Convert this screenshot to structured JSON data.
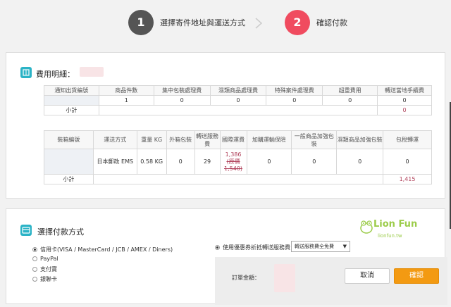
{
  "steps": {
    "step1": {
      "number": "1",
      "label": "選擇寄件地址與運送方式"
    },
    "step2": {
      "number": "2",
      "label": "確認付款"
    }
  },
  "fee": {
    "title": "費用明細：",
    "table1": {
      "headers": [
        "通知出貨編號",
        "商品件數",
        "集中包裝處理費",
        "濕類商品處理費",
        "特殊案件處理費",
        "超重費用",
        "轉送當地手續費"
      ],
      "row": [
        "",
        "1",
        "0",
        "0",
        "0",
        "0",
        "0"
      ],
      "subtotal_label": "小計",
      "subtotal_value": "0"
    },
    "table2": {
      "headers": [
        "裝箱編號",
        "運送方式",
        "重量 KG",
        "外箱包裝",
        "轉送服務費",
        "國際運費",
        "加購運輸保險",
        "一般商品加強包裝",
        "濕類商品加強包裝",
        "包稅轉運"
      ],
      "row": {
        "box_id": "",
        "method": "日本郵政 EMS",
        "weight": "0.58 KG",
        "box_pack": "0",
        "service_fee": "29",
        "intl_fee": "1,386",
        "intl_fee_note": "(原價",
        "intl_fee_orig": "1,540)",
        "insurance": "0",
        "general_pack": "0",
        "wet_pack": "0",
        "tax_transfer": "0"
      },
      "subtotal_label": "小計",
      "subtotal_value": "1,415"
    }
  },
  "payment": {
    "title": "選擇付款方式",
    "options": [
      "信用卡(VISA / MasterCard / JCB / AMEX / Diners)",
      "PayPal",
      "支付寶",
      "銀聯卡"
    ],
    "coupon_label": "使用優惠券折抵轉送服務費",
    "coupon_select": "轉送服務費全免費",
    "order_total_label": "訂單金額：",
    "cancel_label": "取消",
    "confirm_label": "確認"
  },
  "logo": {
    "text": "Lion Fun",
    "sub": "lionfun.tw"
  },
  "colors": {
    "step2": "#f04b5f",
    "confirm": "#f39a12",
    "icon": "#2bb3c6",
    "accent_red": "#b0405a"
  }
}
